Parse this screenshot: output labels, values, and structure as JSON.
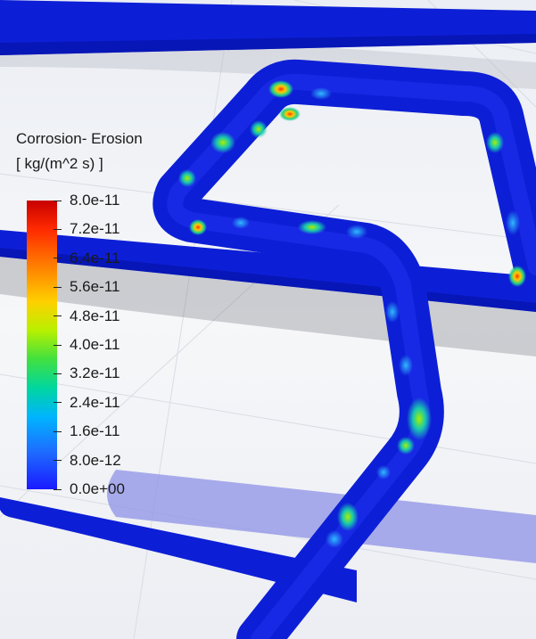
{
  "legend": {
    "title": "Corrosion- Erosion",
    "units": "[ kg/(m^2 s) ]",
    "ticks": [
      "8.0e-11",
      "7.2e-11",
      "6.4e-11",
      "5.6e-11",
      "4.8e-11",
      "4.0e-11",
      "3.2e-11",
      "2.4e-11",
      "1.6e-11",
      "8.0e-12",
      "0.0e+00"
    ],
    "colormap": [
      "#c80000",
      "#ff2a00",
      "#ff7a00",
      "#ffd000",
      "#b8f000",
      "#40e040",
      "#00d6a0",
      "#00b4ff",
      "#1e6cff",
      "#1a1aff"
    ]
  },
  "scene": {
    "background": "#f2f3f7",
    "pipe_color": "#0d1fd6",
    "shadow_color": "#9c9ee8"
  }
}
